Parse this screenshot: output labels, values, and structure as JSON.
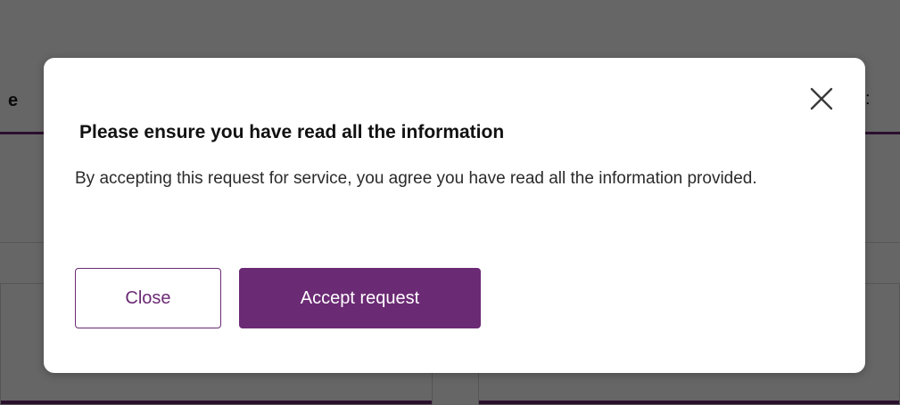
{
  "background_page": {
    "partial_tab_letter": "e",
    "partial_right_glyph": ":"
  },
  "modal": {
    "title": "Please ensure you have read all the information",
    "body": "By accepting this request for service, you agree you have read all the information provided.",
    "close_icon": "close-icon",
    "buttons": {
      "close_label": "Close",
      "accept_label": "Accept request"
    }
  },
  "colors": {
    "accent": "#6b2a74",
    "overlay": "rgba(0,0,0,0.6)",
    "modal_background": "#ffffff"
  }
}
